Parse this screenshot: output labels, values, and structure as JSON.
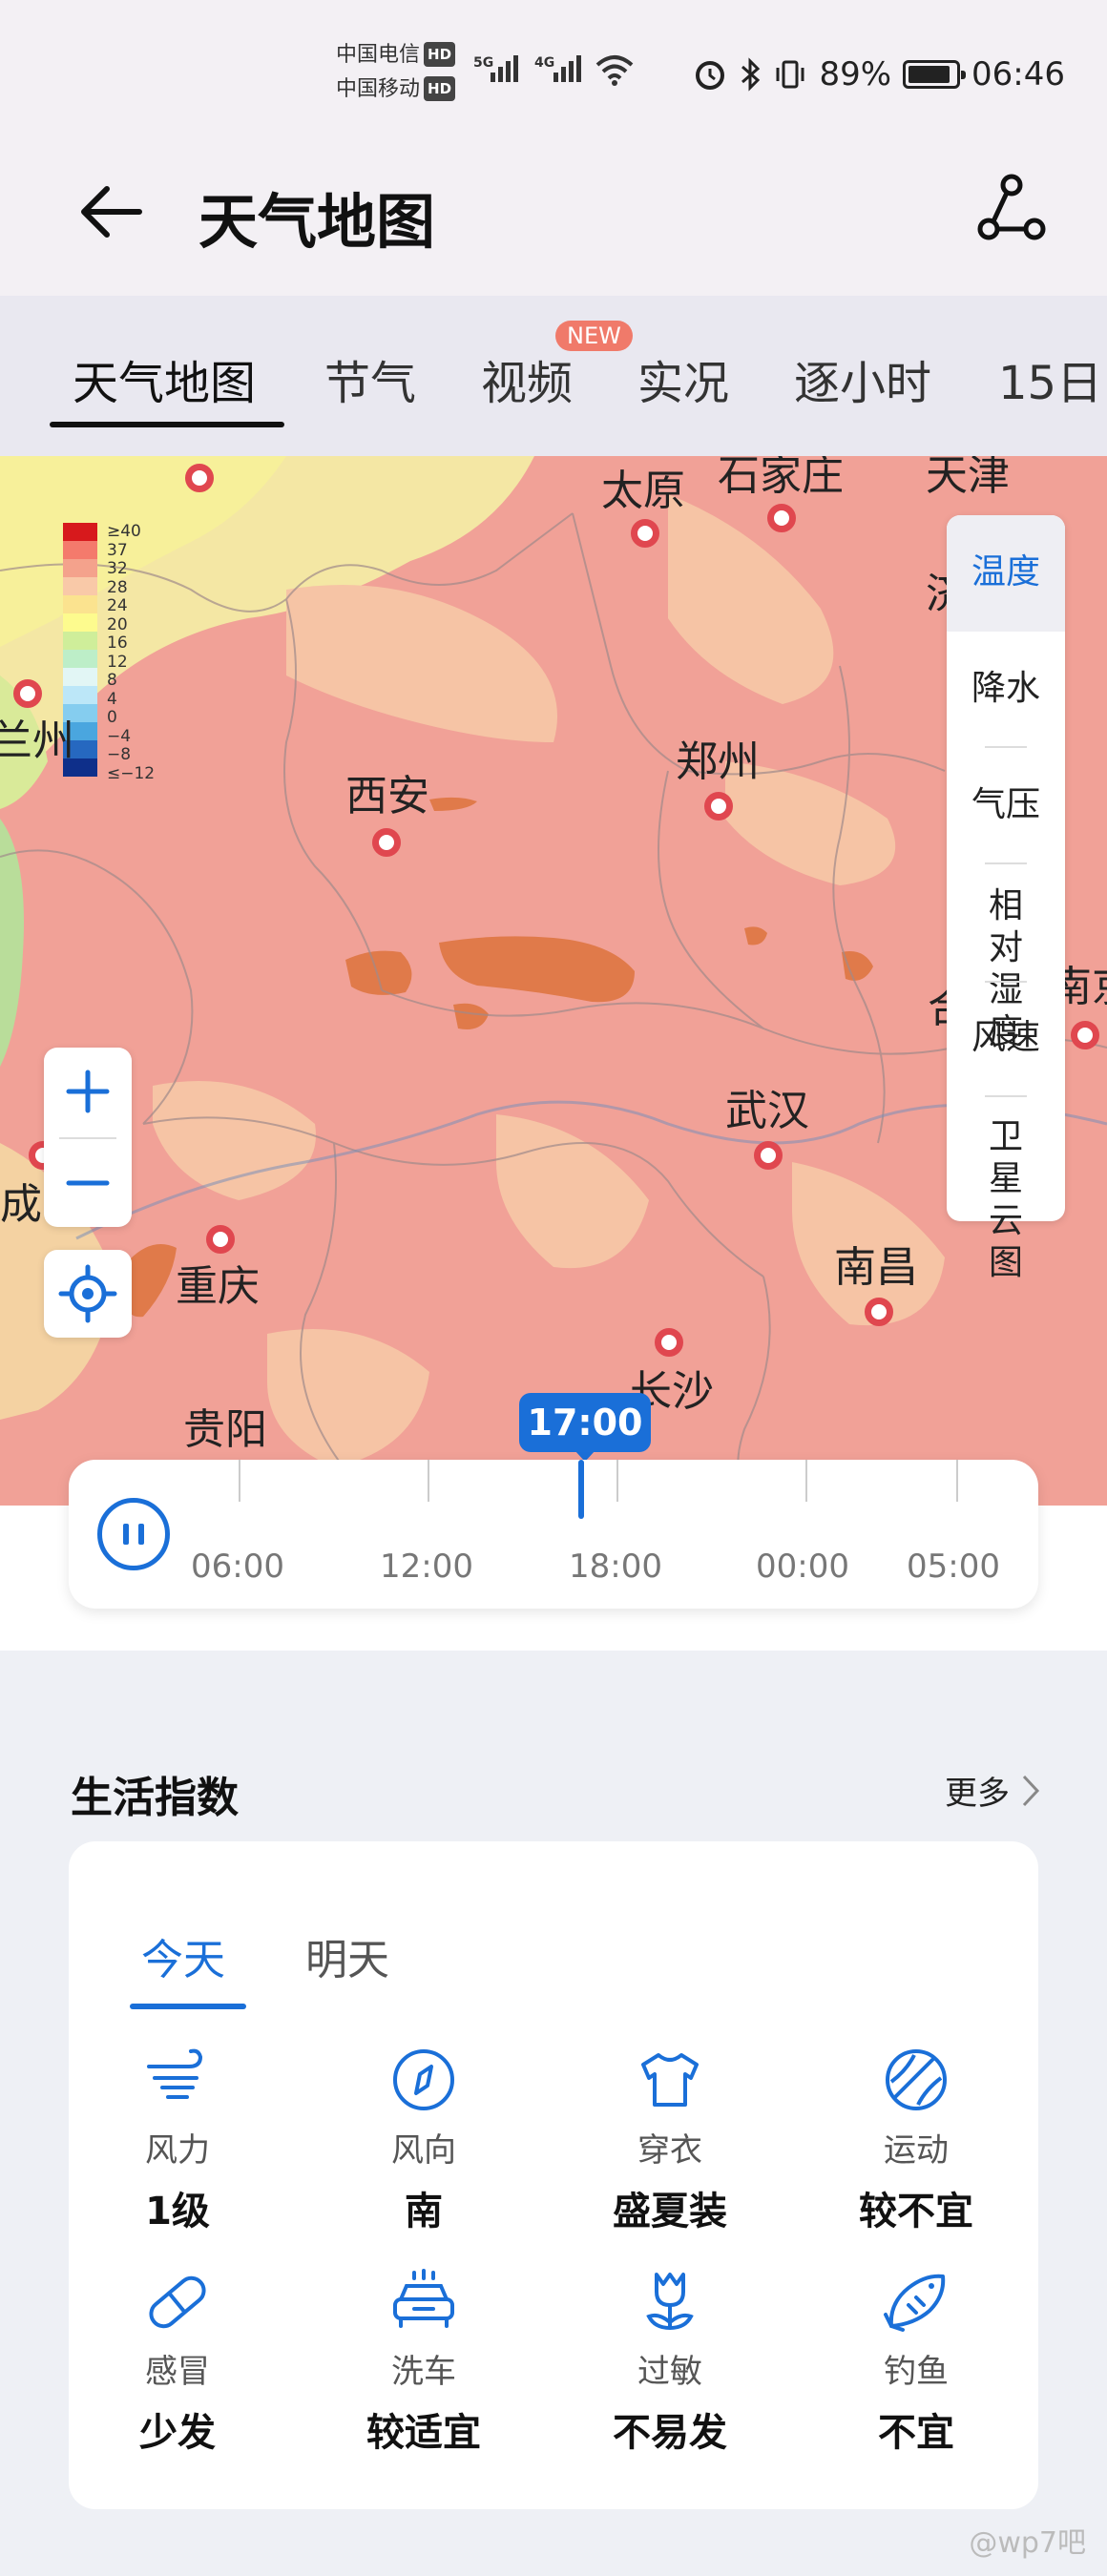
{
  "status_bar": {
    "carrier1": "中国电信",
    "carrier2": "中国移动",
    "hd": "HD",
    "net1": "5G",
    "net2": "4G",
    "battery_percent": "89%",
    "battery_level": 0.89,
    "time": "06:46"
  },
  "header": {
    "title": "天气地图"
  },
  "tabs": [
    {
      "label": "天气地图"
    },
    {
      "label": "节气"
    },
    {
      "label": "视频",
      "badge": "NEW"
    },
    {
      "label": "实况"
    },
    {
      "label": "逐小时"
    },
    {
      "label": "15日"
    }
  ],
  "map": {
    "legend": [
      "≥40",
      "37",
      "32",
      "28",
      "24",
      "20",
      "16",
      "12",
      "8",
      "4",
      "0",
      "−4",
      "−8",
      "≤−12"
    ],
    "legend_colors": [
      "#d7191c",
      "#f47a6c",
      "#f4a28c",
      "#f9c9a8",
      "#fbe38f",
      "#fdfb8e",
      "#cfee9a",
      "#bdeec8",
      "#e2f6f5",
      "#bce7f8",
      "#85cdef",
      "#4aa6df",
      "#2668c0",
      "#0e2f8a"
    ],
    "cities": [
      "太原",
      "石家庄",
      "天津",
      "郑州",
      "西安",
      "兰州",
      "南京",
      "武汉",
      "成",
      "重庆",
      "南昌",
      "长沙",
      "贵阳",
      "济",
      "合"
    ],
    "layers": [
      "温度",
      "降水",
      "气压",
      "相对湿度",
      "风速",
      "卫星云图"
    ],
    "active_layer": "温度"
  },
  "timeline": {
    "current": "17:00",
    "ticks": [
      "06:00",
      "12:00",
      "18:00",
      "00:00",
      "05:00"
    ]
  },
  "life_index": {
    "title": "生活指数",
    "more": "更多",
    "day_tabs": [
      "今天",
      "明天"
    ],
    "items": [
      {
        "icon": "wind-icon",
        "name": "风力",
        "value": "1级"
      },
      {
        "icon": "compass-icon",
        "name": "风向",
        "value": "南"
      },
      {
        "icon": "tshirt-icon",
        "name": "穿衣",
        "value": "盛夏装"
      },
      {
        "icon": "sports-ball-icon",
        "name": "运动",
        "value": "较不宜"
      },
      {
        "icon": "pill-icon",
        "name": "感冒",
        "value": "少发"
      },
      {
        "icon": "car-wash-icon",
        "name": "洗车",
        "value": "较适宜"
      },
      {
        "icon": "flower-icon",
        "name": "过敏",
        "value": "不易发"
      },
      {
        "icon": "fish-icon",
        "name": "钓鱼",
        "value": "不宜"
      }
    ]
  },
  "accent_color": "#1a6fd8",
  "watermark": "@wp7吧"
}
